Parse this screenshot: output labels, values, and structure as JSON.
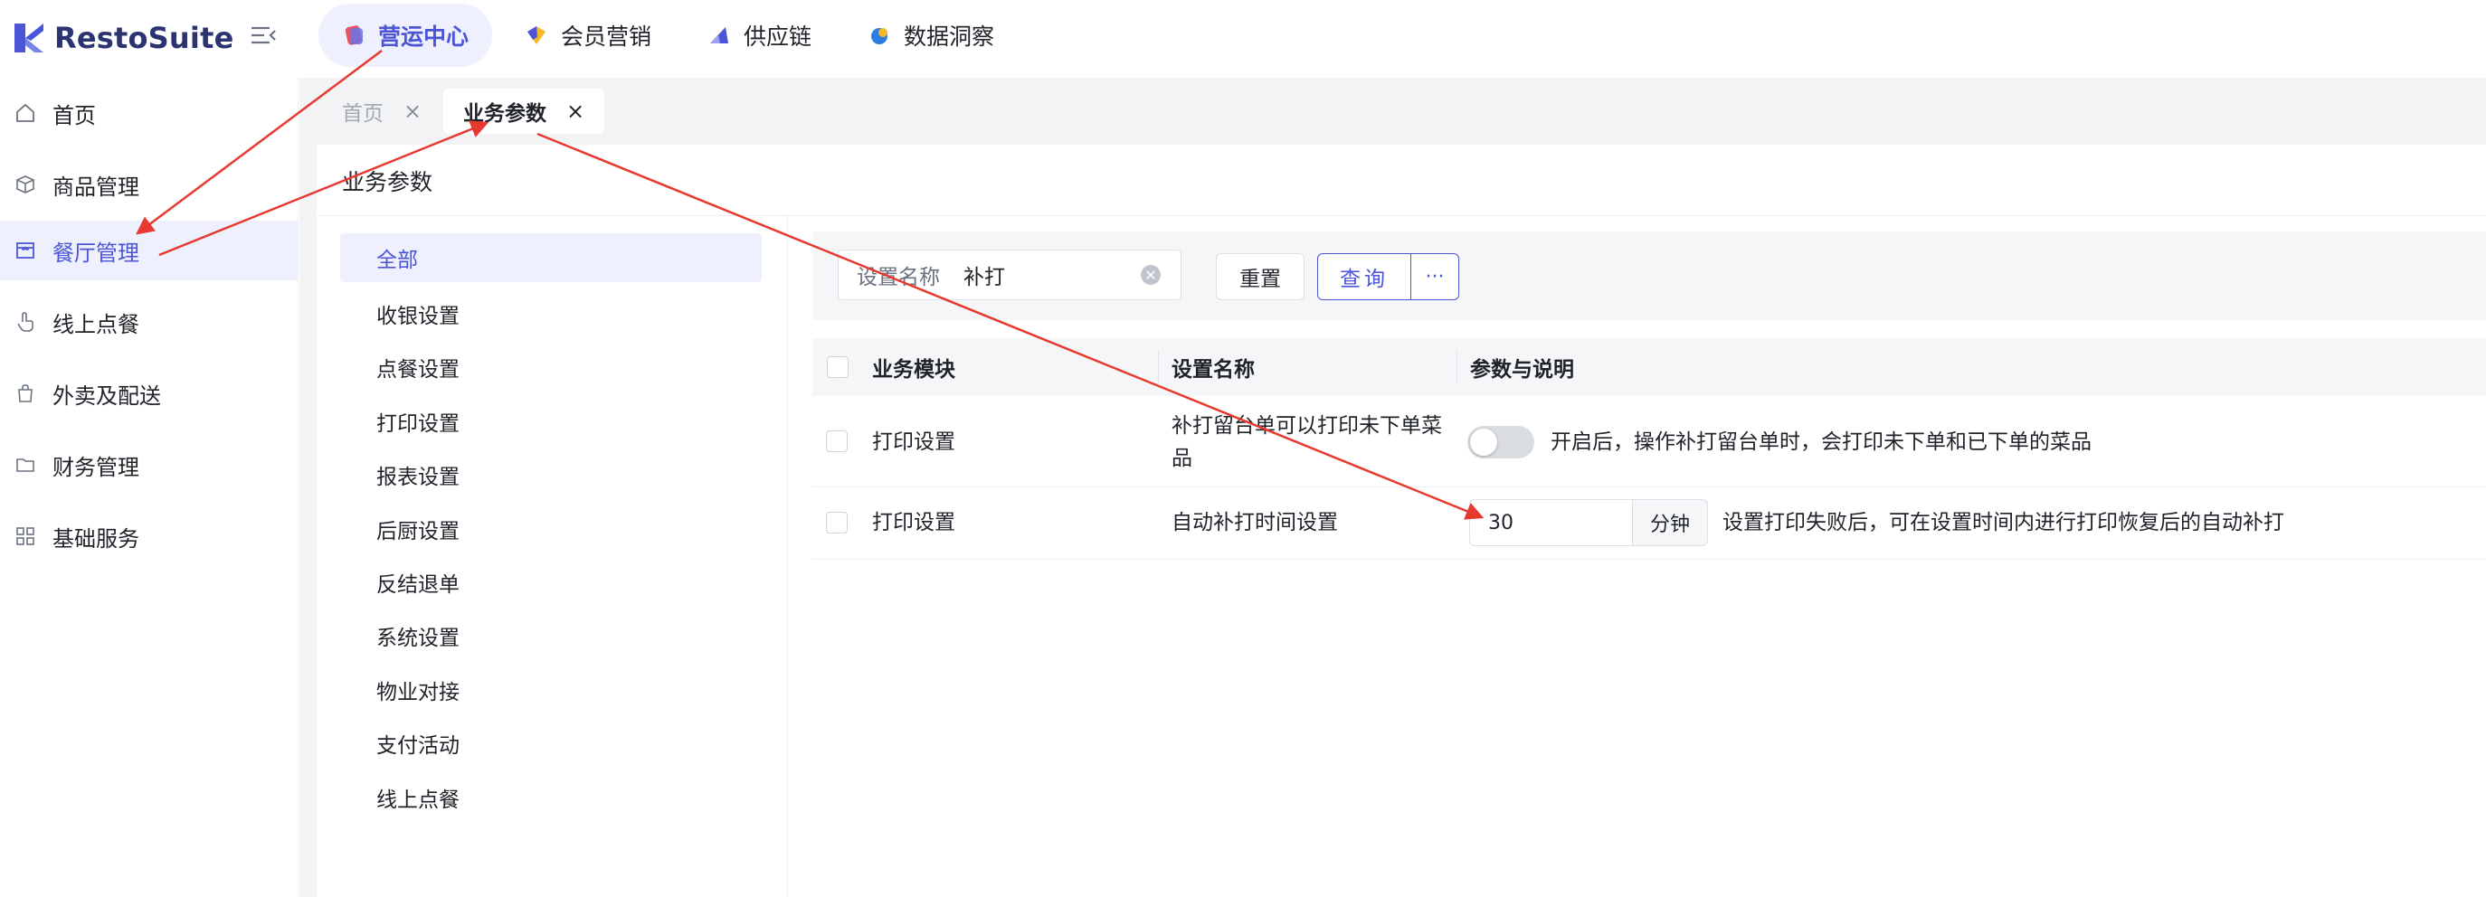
{
  "app": {
    "name": "RestoSuite",
    "brand_color": "#4b55d6"
  },
  "top_nav": [
    {
      "label": "营运中心",
      "icon": "operations-icon",
      "active": true
    },
    {
      "label": "会员营销",
      "icon": "membership-icon",
      "active": false
    },
    {
      "label": "供应链",
      "icon": "supply-chain-icon",
      "active": false
    },
    {
      "label": "数据洞察",
      "icon": "data-insight-icon",
      "active": false
    }
  ],
  "sidebar": {
    "items": [
      {
        "label": "首页",
        "icon": "home-icon"
      },
      {
        "label": "商品管理",
        "icon": "box-icon"
      },
      {
        "label": "餐厅管理",
        "icon": "store-icon",
        "active": true
      },
      {
        "label": "线上点餐",
        "icon": "hand-tap-icon"
      },
      {
        "label": "外卖及配送",
        "icon": "bag-icon"
      },
      {
        "label": "财务管理",
        "icon": "folder-icon"
      },
      {
        "label": "基础服务",
        "icon": "grid-icon"
      }
    ]
  },
  "page_tabs": [
    {
      "label": "首页",
      "close": "×",
      "active": false
    },
    {
      "label": "业务参数",
      "close": "×",
      "active": true
    }
  ],
  "panel": {
    "title": "业务参数",
    "categories": [
      "全部",
      "收银设置",
      "点餐设置",
      "打印设置",
      "报表设置",
      "后厨设置",
      "反结退单",
      "系统设置",
      "物业对接",
      "支付活动",
      "线上点餐"
    ],
    "active_category": "全部"
  },
  "search": {
    "label": "设置名称",
    "value": "补打",
    "clear_icon": "clear-circle-icon",
    "reset_label": "重置",
    "query_label": "查询",
    "more_label": "···"
  },
  "table": {
    "headers": [
      "业务模块",
      "设置名称",
      "参数与说明"
    ],
    "rows": [
      {
        "module": "打印设置",
        "name": "补打留台单可以打印未下单菜品",
        "toggle_on": false,
        "description": "开启后，操作补打留台单时，会打印未下单和已下单的菜品"
      },
      {
        "module": "打印设置",
        "name": "自动补打时间设置",
        "input_value": "30",
        "unit": "分钟",
        "description": "设置打印失败后，可在设置时间内进行打印恢复后的自动补打"
      }
    ]
  },
  "annotation_color": "#e8392f"
}
